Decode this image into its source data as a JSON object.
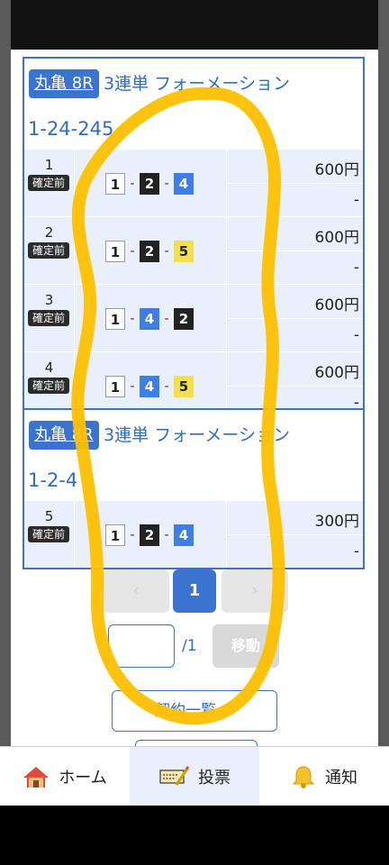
{
  "tickets": [
    {
      "venue": "丸亀 8R",
      "bet_type": "3連単 フォーメーション",
      "combination": "1-24-245",
      "rows": [
        {
          "num": "1",
          "status": "確定前",
          "boats": [
            "1",
            "2",
            "4"
          ],
          "amount": "600円",
          "payout": "-"
        },
        {
          "num": "2",
          "status": "確定前",
          "boats": [
            "1",
            "2",
            "5"
          ],
          "amount": "600円",
          "payout": "-"
        },
        {
          "num": "3",
          "status": "確定前",
          "boats": [
            "1",
            "4",
            "2"
          ],
          "amount": "600円",
          "payout": "-"
        },
        {
          "num": "4",
          "status": "確定前",
          "boats": [
            "1",
            "4",
            "5"
          ],
          "amount": "600円",
          "payout": "-"
        }
      ]
    },
    {
      "venue": "丸亀 8R",
      "bet_type": "3連単 フォーメーション",
      "combination": "1-2-4",
      "rows": [
        {
          "num": "5",
          "status": "確定前",
          "boats": [
            "1",
            "2",
            "4"
          ],
          "amount": "300円",
          "payout": "-"
        }
      ]
    }
  ],
  "pagination": {
    "prev": "‹",
    "current": "1",
    "next": "›",
    "total": "/1",
    "go_label": "移動"
  },
  "list_button": "契約一覧 ^",
  "tabs": [
    {
      "label": "ホーム",
      "icon": "home-icon"
    },
    {
      "label": "投票",
      "icon": "ticket-icon",
      "active": true
    },
    {
      "label": "通知",
      "icon": "bell-icon"
    }
  ]
}
